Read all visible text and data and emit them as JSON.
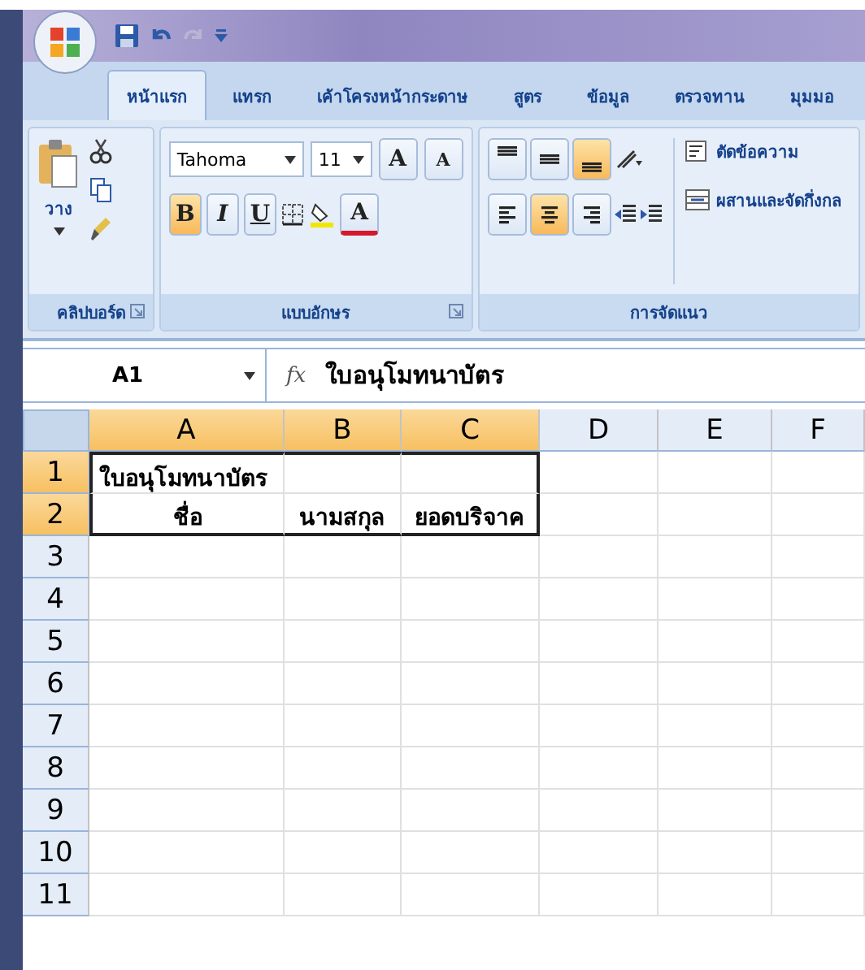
{
  "tabs": [
    {
      "label": "หน้าแรก",
      "selected": true
    },
    {
      "label": "แทรก",
      "selected": false
    },
    {
      "label": "เค้าโครงหน้ากระดาษ",
      "selected": false
    },
    {
      "label": "สูตร",
      "selected": false
    },
    {
      "label": "ข้อมูล",
      "selected": false
    },
    {
      "label": "ตรวจทาน",
      "selected": false
    },
    {
      "label": "มุมมอ",
      "selected": false
    }
  ],
  "clipboard_group": {
    "paste_label": "วาง",
    "title": "คลิปบอร์ด"
  },
  "font_group": {
    "font_name": "Tahoma",
    "font_size": "11",
    "grow_label": "A",
    "shrink_label": "A",
    "font_color_label": "A",
    "title": "แบบอักษร",
    "style_buttons": [
      {
        "label": "B",
        "selected": true
      },
      {
        "label": "I",
        "selected": false
      },
      {
        "label": "U",
        "selected": false
      }
    ]
  },
  "alignment_group": {
    "vertical_align": [
      {
        "selected": false
      },
      {
        "selected": false
      },
      {
        "selected": true
      }
    ],
    "horizontal_align": [
      {
        "selected": false
      },
      {
        "selected": true
      },
      {
        "selected": false
      }
    ],
    "wrap_label": "ตัดข้อความ",
    "merge_label": "ผสานและจัดกึ่งกล",
    "title": "การจัดแนว"
  },
  "formula_bar": {
    "name_box": "A1",
    "function_label": "fx",
    "value": "ใบอนุโมทนาบัตร"
  },
  "sheet": {
    "columns": [
      {
        "label": "A",
        "selected": true
      },
      {
        "label": "B",
        "selected": true
      },
      {
        "label": "C",
        "selected": true
      },
      {
        "label": "D",
        "selected": false
      },
      {
        "label": "E",
        "selected": false
      },
      {
        "label": "F",
        "selected": false
      }
    ],
    "rows": [
      {
        "label": "1",
        "selected": true,
        "cells": [
          {
            "text": "ใบอนุโมทนาบัตร",
            "kind": "title"
          }
        ]
      },
      {
        "label": "2",
        "selected": true,
        "cells": [
          {
            "text": "ชื่อ",
            "kind": "heading"
          },
          {
            "text": "นามสกุล",
            "kind": "heading"
          },
          {
            "text": "ยอดบริจาค",
            "kind": "heading"
          }
        ]
      },
      {
        "label": "3",
        "selected": false,
        "cells": []
      },
      {
        "label": "4",
        "selected": false,
        "cells": []
      },
      {
        "label": "5",
        "selected": false,
        "cells": []
      },
      {
        "label": "6",
        "selected": false,
        "cells": []
      },
      {
        "label": "7",
        "selected": false,
        "cells": []
      },
      {
        "label": "8",
        "selected": false,
        "cells": []
      },
      {
        "label": "9",
        "selected": false,
        "cells": []
      },
      {
        "label": "10",
        "selected": false,
        "cells": []
      },
      {
        "label": "11",
        "selected": false,
        "cells": []
      }
    ]
  }
}
